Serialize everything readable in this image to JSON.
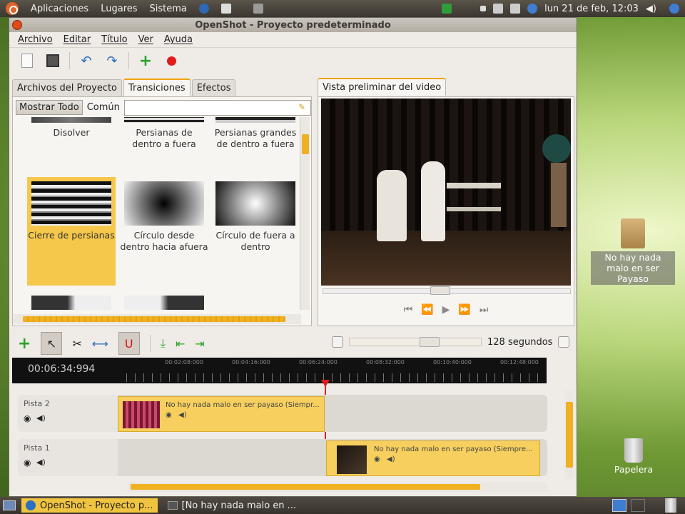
{
  "topbar": {
    "menus": [
      "Aplicaciones",
      "Lugares",
      "Sistema"
    ],
    "clock": "lun 21 de feb, 12:03"
  },
  "window": {
    "title": "OpenShot - Proyecto predeterminado"
  },
  "menubar": [
    "Archivo",
    "Editar",
    "Título",
    "Ver",
    "Ayuda"
  ],
  "tabs": {
    "project_files": "Archivos del Proyecto",
    "transitions": "Transiciones",
    "effects": "Efectos",
    "preview": "Vista preliminar del video"
  },
  "filter": {
    "show_all": "Mostrar Todo",
    "common": "Común",
    "search_value": ""
  },
  "transitions": [
    {
      "label": "Disolver"
    },
    {
      "label": "Persianas de dentro a fuera"
    },
    {
      "label": "Persianas grandes de dentro a fuera"
    },
    {
      "label": "Cierre de persianas",
      "selected": true
    },
    {
      "label": "Círculo desde dentro hacia afuera"
    },
    {
      "label": "Círculo de fuera a dentro"
    }
  ],
  "timeline": {
    "current_time": "00:06:34:994",
    "ticks": [
      "00:02:08:000",
      "00:04:16:000",
      "00:06:24:000",
      "00:08:32:000",
      "00:10:40:000",
      "00:12:48:000"
    ],
    "zoom_label": "128 segundos"
  },
  "tracks": [
    {
      "name": "Pista 2",
      "clip": "No hay nada malo en ser payaso (Siempr..."
    },
    {
      "name": "Pista 1",
      "clip": "No hay nada malo en ser payaso (Siempre..."
    }
  ],
  "taskbar": {
    "items": [
      "OpenShot - Proyecto p...",
      "[No hay nada malo en ..."
    ]
  },
  "desktop": {
    "folder": "No hay nada malo en ser Payaso",
    "trash": "Papelera"
  },
  "colors": {
    "accent": "#f0a30a",
    "selection": "#f5c74a",
    "clip": "#f6cf5e"
  }
}
